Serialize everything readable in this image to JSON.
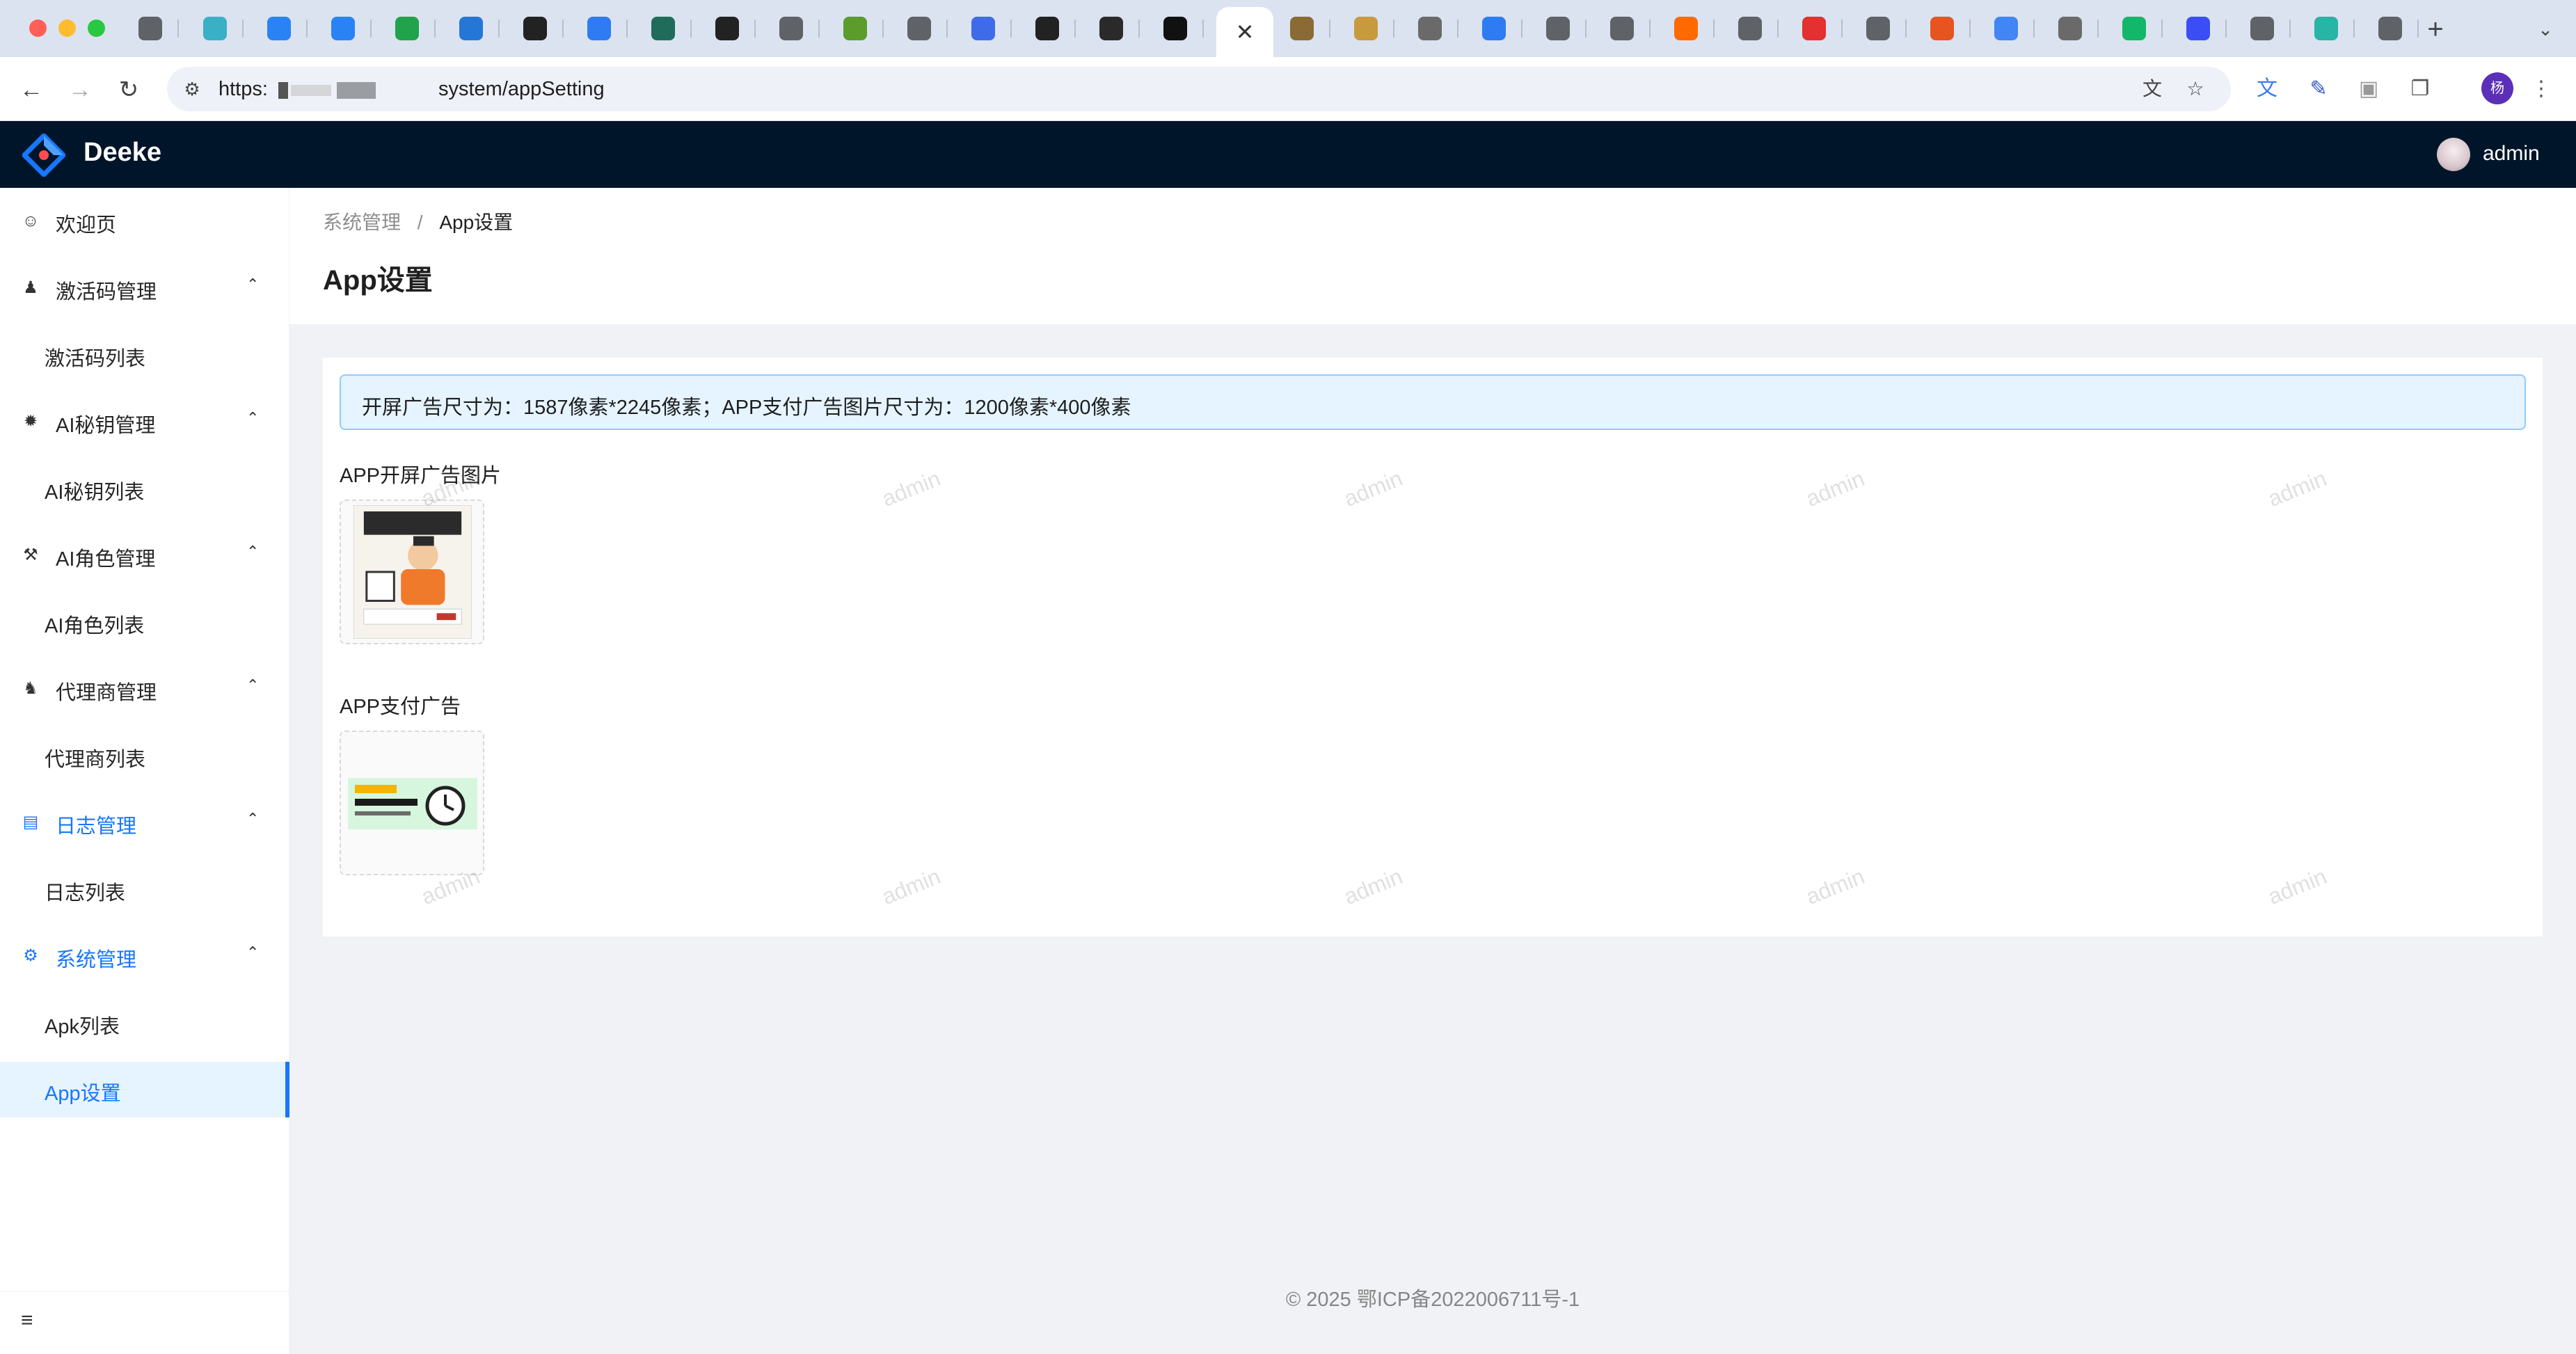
{
  "browser": {
    "tab_icon_colors": [
      "#5f6368",
      "#3ab0c7",
      "#2a83f5",
      "#2a83f5",
      "#20a34a",
      "#2477d6",
      "#222222",
      "#2f7bf3",
      "#1f6c5a",
      "#222222",
      "#5f6368",
      "#5b9c2b",
      "#5f6368",
      "#3f6be8",
      "#222222",
      "#2a2a2a",
      "#111111",
      "#8a6b35",
      "#c79a3d",
      "#6a6a6a",
      "#2f7bf3",
      "#5f6368",
      "#5f6368",
      "#ff6a00",
      "#5f6368",
      "#e33030",
      "#5f6368",
      "#e6541f",
      "#4285f4",
      "#6a6a6a",
      "#12b76a",
      "#3b4ef5",
      "#5f6368",
      "#27b5a5",
      "#5f6368"
    ],
    "active_tab_close": "✕",
    "new_tab": "+",
    "tab_menu": "⌄",
    "url_prefix": "https:",
    "url_suffix": "system/appSetting",
    "profile_initial": "杨"
  },
  "header": {
    "app_name": "Deeke",
    "username": "admin"
  },
  "sidebar": {
    "items": [
      {
        "label": "欢迎页",
        "icon": "smile-icon"
      },
      {
        "label": "激活码管理",
        "icon": "user-icon",
        "arrow": "⌃"
      },
      {
        "label": "激活码列表"
      },
      {
        "label": "AI秘钥管理",
        "icon": "openai-icon",
        "arrow": "⌃"
      },
      {
        "label": "AI秘钥列表"
      },
      {
        "label": "AI角色管理",
        "icon": "robot-icon",
        "arrow": "⌃"
      },
      {
        "label": "AI角色列表"
      },
      {
        "label": "代理商管理",
        "icon": "cluster-icon",
        "arrow": "⌃"
      },
      {
        "label": "代理商列表"
      },
      {
        "label": "日志管理",
        "icon": "log-icon",
        "arrow": "⌃"
      },
      {
        "label": "日志列表"
      },
      {
        "label": "系统管理",
        "icon": "setting-icon",
        "arrow": "⌃"
      },
      {
        "label": "Apk列表"
      },
      {
        "label": "App设置"
      }
    ]
  },
  "breadcrumb": {
    "parent": "系统管理",
    "separator": "/",
    "current": "App设置"
  },
  "page": {
    "title": "App设置",
    "alert": "开屏广告尺寸为：1587像素*2245像素；APP支付广告图片尺寸为：1200像素*400像素",
    "splash_label": "APP开屏广告图片",
    "pay_label": "APP支付广告",
    "watermark": "admin"
  },
  "footer": {
    "text": "© 2025 鄂ICP备2022006711号-1"
  },
  "colors": {
    "primary": "#1677ff",
    "header_bg": "#001529",
    "alert_bg": "#e6f4ff",
    "alert_border": "#91caff"
  }
}
